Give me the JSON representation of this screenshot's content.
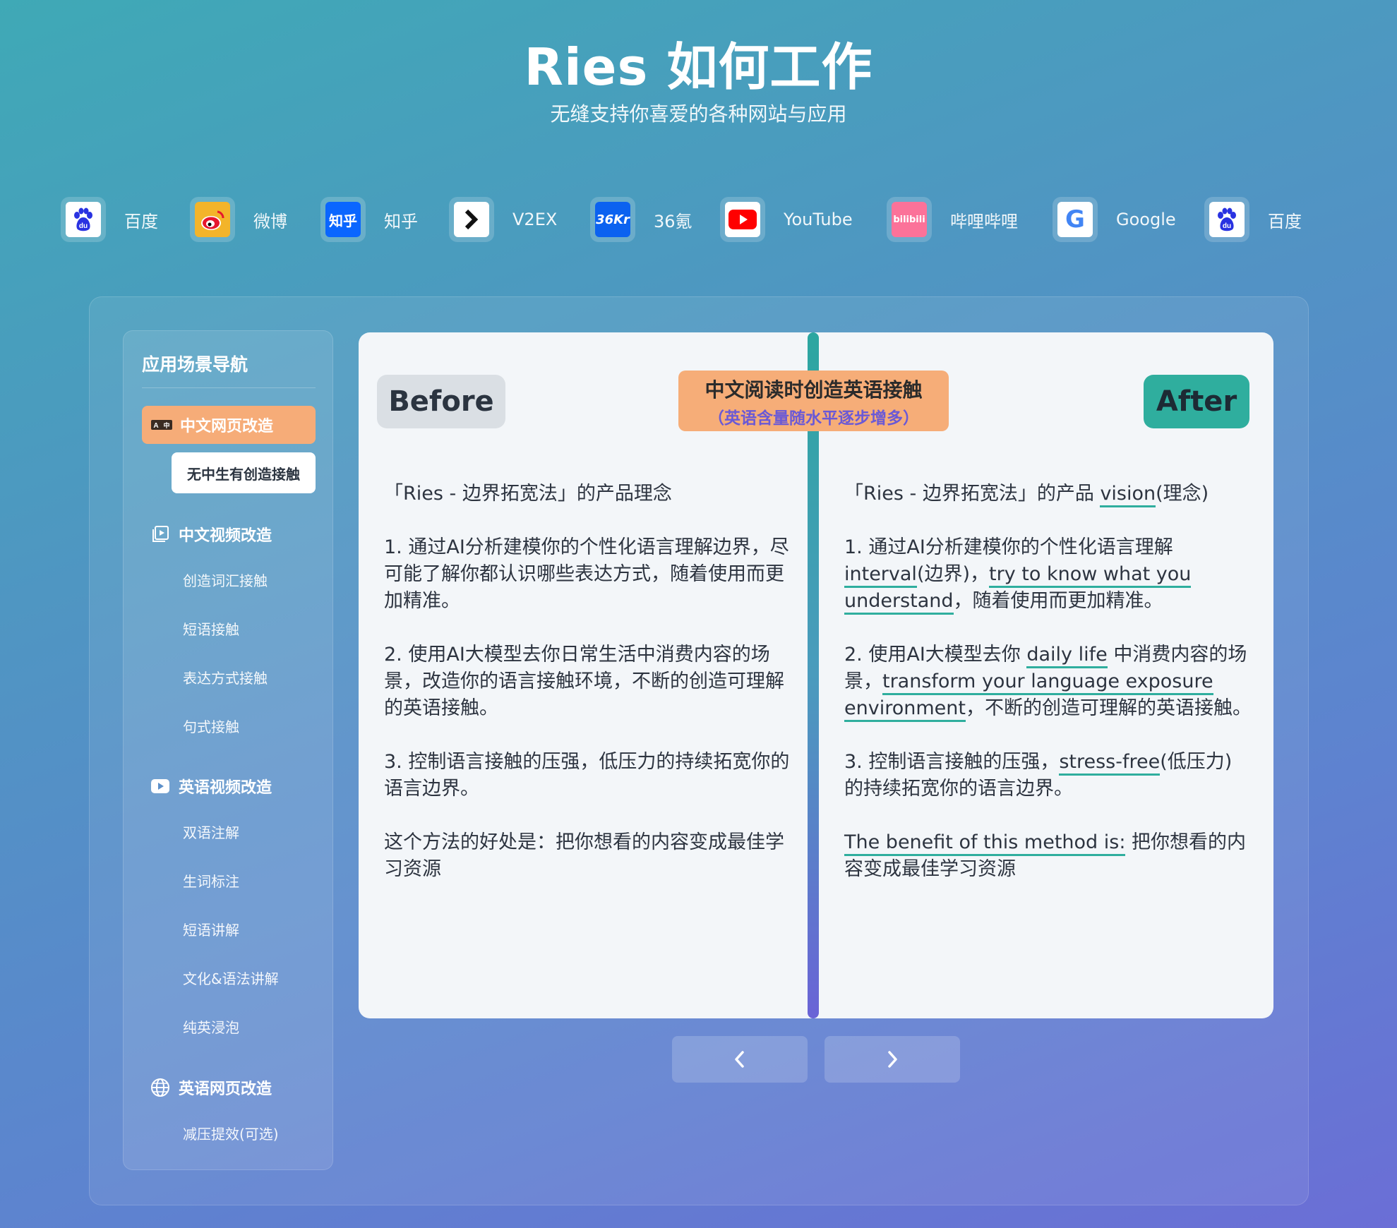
{
  "hero": {
    "title": "Ries 如何工作",
    "subtitle": "无缝支持你喜爱的各种网站与应用"
  },
  "sites": [
    {
      "label": "百度",
      "icon": "baidu-icon"
    },
    {
      "label": "微博",
      "icon": "weibo-icon"
    },
    {
      "label": "知乎",
      "icon": "zhihu-icon",
      "icon_text": "知乎"
    },
    {
      "label": "V2EX",
      "icon": "v2ex-icon"
    },
    {
      "label": "36氪",
      "icon": "36kr-icon",
      "icon_text": "36Kr"
    },
    {
      "label": "YouTube",
      "icon": "youtube-icon"
    },
    {
      "label": "哔哩哔哩",
      "icon": "bilibili-icon",
      "icon_text": "bilibili"
    },
    {
      "label": "Google",
      "icon": "google-icon",
      "icon_text": "G"
    },
    {
      "label": "百度",
      "icon": "baidu-icon"
    }
  ],
  "nav": {
    "title": "应用场景导航",
    "active_group": "中文网页改造",
    "active_item": "无中生有创造接触",
    "groups": [
      {
        "label": "中文视频改造",
        "icon": "video-frame-icon",
        "items": [
          "创造词汇接触",
          "短语接触",
          "表达方式接触",
          "句式接触"
        ]
      },
      {
        "label": "英语视频改造",
        "icon": "play-icon",
        "items": [
          "双语注解",
          "生词标注",
          "短语讲解",
          "文化&语法讲解",
          "纯英浸泡"
        ]
      },
      {
        "label": "英语网页改造",
        "icon": "globe-icon",
        "items": [
          "减压提效(可选)"
        ]
      }
    ]
  },
  "card": {
    "before_label": "Before",
    "after_label": "After",
    "center_title": "中文阅读时创造英语接触",
    "center_subtitle": "（英语含量随水平逐步增多）",
    "before": {
      "title": "「Ries - 边界拓宽法」的产品理念",
      "p1": "1. 通过AI分析建模你的个性化语言理解边界，尽可能了解你都认识哪些表达方式，随着使用而更加精准。",
      "p2": "2. 使用AI大模型去你日常生活中消费内容的场景，改造你的语言接触环境，不断的创造可理解的英语接触。",
      "p3": "3. 控制语言接触的压强，低压力的持续拓宽你的语言边界。",
      "p4": "这个方法的好处是：把你想看的内容变成最佳学习资源"
    },
    "after": {
      "title_a": "「Ries - 边界拓宽法」的产品 ",
      "title_hl": "vision",
      "title_b": "(理念)",
      "p1_a": "1. 通过AI分析建模你的个性化语言理解 ",
      "p1_hl1": "interval",
      "p1_b": "(边界)，",
      "p1_hl2": "try to know what you understand",
      "p1_c": "，随着使用而更加精准。",
      "p2_a": "2. 使用AI大模型去你 ",
      "p2_hl1": "daily life",
      "p2_b": " 中消费内容的场景，",
      "p2_hl2": "transform your language exposure environment",
      "p2_c": "，不断的创造可理解的英语接触。",
      "p3_a": "3. 控制语言接触的压强，",
      "p3_hl": "stress-free",
      "p3_b": "(低压力) 的持续拓宽你的语言边界。",
      "p4_hl": "The benefit of this method is:",
      "p4_b": " 把你想看的内容变成最佳学习资源"
    }
  },
  "pager": {
    "prev_icon": "chevron-left-icon",
    "next_icon": "chevron-right-icon"
  },
  "colors": {
    "accent_orange": "#f6ac78",
    "accent_teal": "#2fae9e",
    "accent_purple": "#6a59d6"
  }
}
